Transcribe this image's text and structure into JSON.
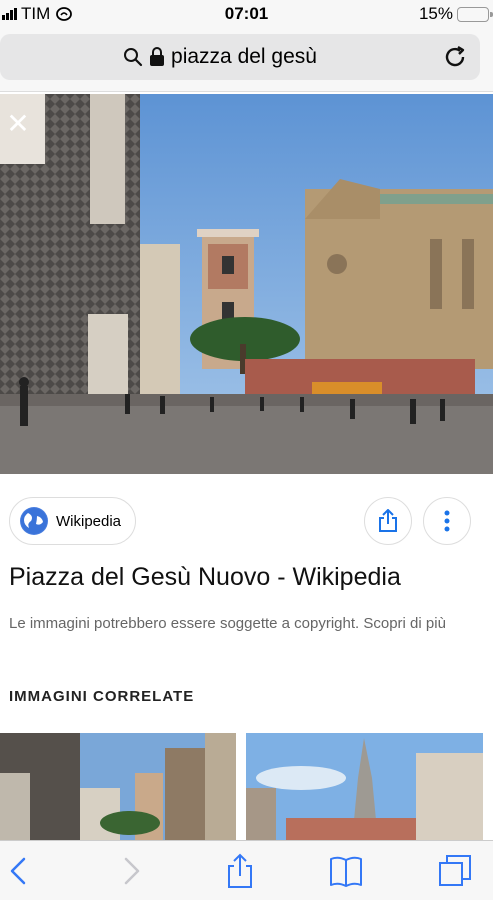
{
  "status": {
    "carrier": "TIM",
    "time": "07:01",
    "battery": "15%",
    "battery_level": 0.15
  },
  "browser": {
    "url_text": "piazza del gesù"
  },
  "result": {
    "source": "Wikipedia",
    "title": "Piazza del Gesù Nuovo - Wikipedia",
    "copyright": "Le immagini potrebbero essere soggette a copyright. Scopri di più",
    "related_heading": "IMMAGINI CORRELATE"
  },
  "colors": {
    "accent": "#1a73e8",
    "ios_blue": "#3478f6",
    "battery": "#f5c400"
  }
}
